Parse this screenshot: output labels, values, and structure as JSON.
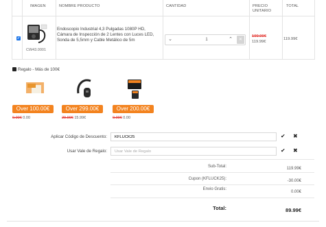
{
  "table": {
    "headers": [
      "IMAGEN",
      "NOMBRE PRODUCTO",
      "CANTIDAD",
      "PRECIO UNITARIO",
      "TOTAL"
    ],
    "item": {
      "checked": "✔",
      "sku": "CW43.0001",
      "name": "Endoscopio Industrial 4,3 Pulgadas 1080P HD, Cámara de Inspección de 2 Lentes con Luces LED, Sonda de 5,5mm y Cable Metálico de 5m",
      "quantity": "1",
      "price_old": "199.99€",
      "price_new": "119.99€",
      "total": "119.99€"
    }
  },
  "gifts": {
    "title": "Regalo - Más de 100€",
    "items": [
      {
        "tag": "Over 100.00€",
        "old_price": "0.00€",
        "price": "0.00"
      },
      {
        "tag": "Over 299.00€",
        "old_price": "29.99€",
        "price": "15.99€"
      },
      {
        "tag": "Over 200.00€",
        "old_price": "0.00€",
        "price": "0.00"
      }
    ]
  },
  "discount": {
    "label": "Aplicar Código de Descuento:",
    "value": "KFLUCK25"
  },
  "voucher": {
    "label": "Usar Vale de Regalo:",
    "placeholder": "Usar Vale de Regalo"
  },
  "summary": {
    "subtotal_label": "Sub-Total:",
    "subtotal": "119.99€",
    "coupon_label": "Cupon (KFLUCK25):",
    "coupon": "-30.00€",
    "shipping_label": "Envio Gratis:",
    "shipping": "0.00€",
    "total_label": "Total:",
    "total": "89.99€"
  },
  "colors": {
    "accent": "#f3831f",
    "checkbox": "#1b74e8",
    "strike": "#e0201a"
  },
  "icons": {
    "apply": "check-icon",
    "remove": "close-icon",
    "gift": "gift-icon"
  }
}
